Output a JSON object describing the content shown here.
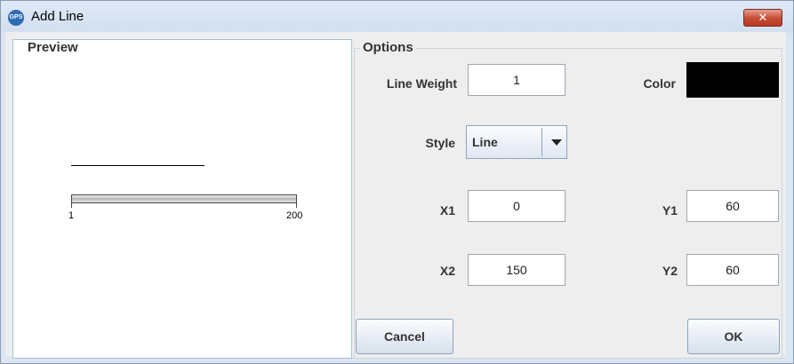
{
  "window": {
    "title": "Add Line",
    "app_icon_text": "GPS",
    "close_symbol": "✕"
  },
  "preview": {
    "legend": "Preview",
    "ruler": {
      "min_label": "1",
      "max_label": "200"
    }
  },
  "options": {
    "legend": "Options",
    "line_weight": {
      "label": "Line Weight",
      "value": "1"
    },
    "color": {
      "label": "Color",
      "value": "#000000"
    },
    "style": {
      "label": "Style",
      "value": "Line"
    },
    "x1": {
      "label": "X1",
      "value": "0"
    },
    "y1": {
      "label": "Y1",
      "value": "60"
    },
    "x2": {
      "label": "X2",
      "value": "150"
    },
    "y2": {
      "label": "Y2",
      "value": "60"
    }
  },
  "buttons": {
    "cancel": "Cancel",
    "ok": "OK"
  },
  "colors": {
    "titlebar": "#d2dff0",
    "panel_bg": "#eeeeee",
    "close_red": "#c74a33"
  }
}
